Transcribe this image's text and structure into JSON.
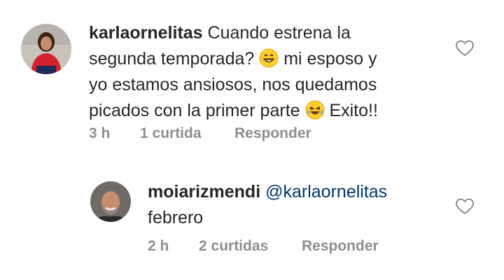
{
  "comments": [
    {
      "username": "karlaornelitas",
      "text_1": "Cuando estrena la",
      "text_2": "segunda temporada?",
      "text_3": "mi esposo y",
      "text_4": "yo estamos ansiosos, nos quedamos",
      "text_5": "picados con la primer parte",
      "text_6": "Exito!!",
      "emoji_1": "grinning-face-icon",
      "emoji_2": "laughing-tears-face-icon",
      "time": "3 h",
      "likes": "1 curtida",
      "reply_label": "Responder",
      "like_icon": "heart-outline-icon"
    },
    {
      "username": "moiarizmendi",
      "mention": "@karlaornelitas",
      "text": "febrero",
      "time": "2 h",
      "likes": "2 curtidas",
      "reply_label": "Responder",
      "like_icon": "heart-outline-icon"
    }
  ],
  "colors": {
    "text": "#262626",
    "meta": "#8e8e8e",
    "mention": "#00376b",
    "heart_stroke": "#8e8e8e"
  }
}
